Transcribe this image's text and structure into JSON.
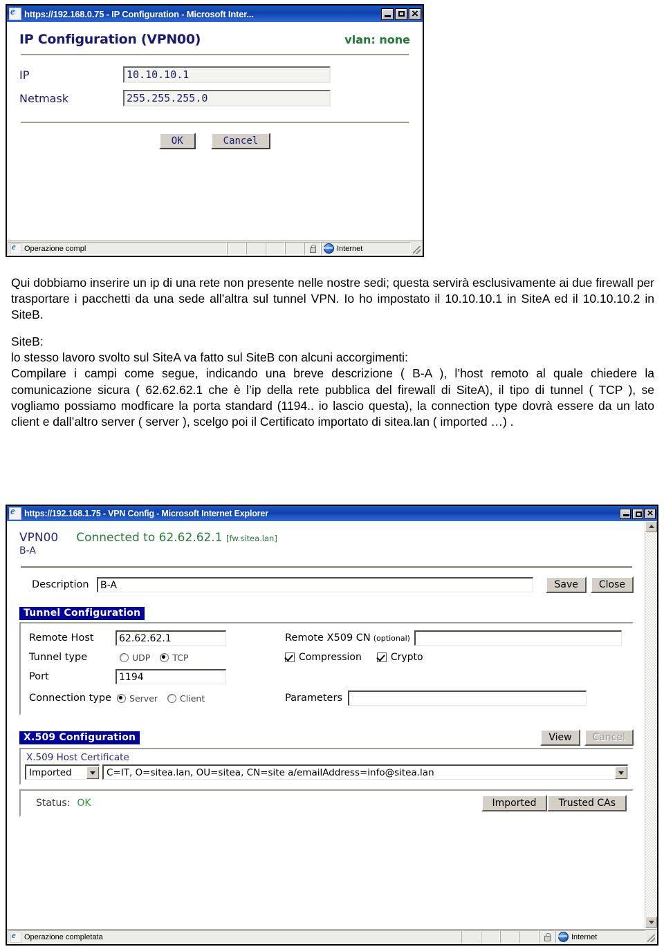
{
  "ip_window": {
    "titlebar": {
      "text": "https://192.168.0.75 - IP Configuration - Microsoft Inter...",
      "icon": "ie-icon",
      "minimize": "minimize-icon",
      "maximize": "maximize-icon",
      "close": "close-icon"
    },
    "heading": "IP Configuration (VPN00)",
    "vlan": "vlan: none",
    "fields": [
      {
        "label": "IP",
        "value": "10.10.10.1"
      },
      {
        "label": "Netmask",
        "value": "255.255.255.0"
      }
    ],
    "buttons": {
      "ok": "OK",
      "cancel": "Cancel"
    },
    "statusbar": {
      "message": "Operazione compl",
      "zone": "Internet",
      "lock": "lock-icon"
    }
  },
  "prose": {
    "para1": "Qui dobbiamo inserire  un ip di una rete non presente nelle nostre sedi; questa servirà esclusivamente ai due firewall per trasportare i pacchetti da una sede all’altra sul tunnel VPN. Io ho impostato il 10.10.10.1 in SiteA ed il 10.10.10.2 in SiteB.",
    "label_siteb": "SiteB:",
    "para2": "lo stesso lavoro svolto sul SiteA va fatto sul SiteB con alcuni accorgimenti:",
    "para3": "Compilare i campi come segue, indicando una breve descrizione ( B-A ), l’host remoto al quale chiedere la comunicazione sicura ( 62.62.62.1 che è l’ip della rete pubblica del firewall di SiteA), il tipo di tunnel ( TCP ), se vogliamo possiamo modficare la porta standard (1194.. io lascio questa), la connection type dovrà essere da un lato client e dall’altro server ( server ), scelgo poi il Certificato importato di sitea.lan ( imported …) ."
  },
  "vpn_window": {
    "titlebar": {
      "text": "https://192.168.1.75 - VPN Config - Microsoft Internet Explorer",
      "icon": "ie-icon",
      "minimize": "minimize-icon",
      "maximize": "maximize-icon",
      "close": "close-icon"
    },
    "header": {
      "vpn_id": "VPN00",
      "connected": "Connected to 62.62.62.1",
      "fw_host": "[fw.sitea.lan]",
      "subtitle": "B-A"
    },
    "description": {
      "label": "Description",
      "value": "B-A",
      "save": "Save",
      "close": "Close"
    },
    "tunnel": {
      "section_title": "Tunnel Configuration",
      "remote_host_label": "Remote Host",
      "remote_host_value": "62.62.62.1",
      "tunnel_type_label": "Tunnel type",
      "tunnel_type_options": [
        {
          "label": "UDP",
          "selected": false
        },
        {
          "label": "TCP",
          "selected": true
        }
      ],
      "port_label": "Port",
      "port_value": "1194",
      "connection_type_label": "Connection type",
      "connection_type_options": [
        {
          "label": "Server",
          "selected": true
        },
        {
          "label": "Client",
          "selected": false
        }
      ],
      "x509cn_label": "Remote X509 CN",
      "x509cn_optional": "(optional)",
      "x509cn_value": "",
      "compression_label": "Compression",
      "compression_checked": true,
      "crypto_label": "Crypto",
      "crypto_checked": true,
      "parameters_label": "Parameters",
      "parameters_value": ""
    },
    "x509": {
      "section_title": "X.509 Configuration",
      "view_button": "View",
      "cancel_button": "Cancel",
      "cancel_disabled": true,
      "host_cert_legend": "X.509 Host Certificate",
      "source_select": "Imported",
      "dn_select": "C=IT, O=sitea.lan, OU=sitea, CN=site a/emailAddress=info@sitea.lan",
      "status_label": "Status:",
      "status_value": "OK",
      "imported_button": "Imported",
      "trusted_cas_button": "Trusted CAs"
    },
    "statusbar": {
      "message": "Operazione completata",
      "zone": "Internet",
      "lock": "lock-icon"
    },
    "scrollbar": {
      "up": "scroll-up-arrow",
      "down": "scroll-down-arrow"
    }
  },
  "colors": {
    "title_blue": "#0a3fa8",
    "section_header_blue": "#00009c",
    "green_status": "#2a9a3b",
    "navy_text": "#1b1b6e"
  }
}
